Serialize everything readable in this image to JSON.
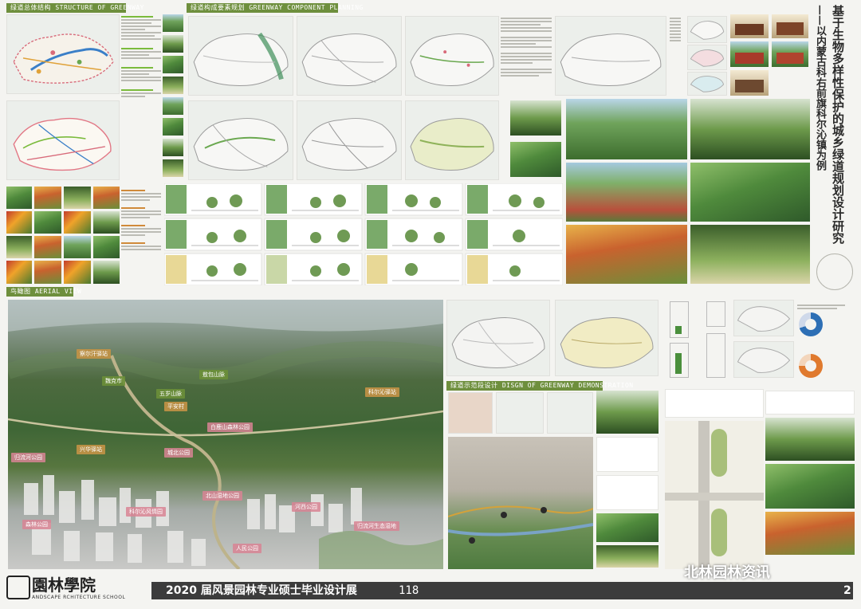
{
  "headers": {
    "structure": "绿道总体结构 STRUCTURE OF GREENWAY",
    "component": "绿道构成要素规划 GREENWAY COMPONENT PLANNING",
    "aerial": "鸟瞰图 AERIAL VIEW",
    "demo": "绿道示范段设计 DISGN OF GREENWAY DEMONSTRATION"
  },
  "title": {
    "main": "基于生物多样性保护的城乡绿道规划设计研究",
    "sub": "——以内蒙古科右前旗科尔沁镇为例"
  },
  "aerial_labels": [
    {
      "text": "察尔汗驿站",
      "style": "o"
    },
    {
      "text": "敖包山脉",
      "style": "g"
    },
    {
      "text": "魏克市",
      "style": "g"
    },
    {
      "text": "五岁山脉",
      "style": "g"
    },
    {
      "text": "平安村",
      "style": "o"
    },
    {
      "text": "科尔沁驿站",
      "style": "p"
    },
    {
      "text": "白鹿山森林公园",
      "style": "p"
    },
    {
      "text": "兴华驿站",
      "style": "o"
    },
    {
      "text": "城北公园",
      "style": "p"
    },
    {
      "text": "归流河公园",
      "style": "p"
    },
    {
      "text": "北山湿地公园",
      "style": "p"
    },
    {
      "text": "科尔沁风情园",
      "style": "p"
    },
    {
      "text": "河西公园",
      "style": "p"
    },
    {
      "text": "归流河生态湿地",
      "style": "p"
    },
    {
      "text": "森林公园",
      "style": "p"
    },
    {
      "text": "人民公园",
      "style": "p"
    }
  ],
  "footer": {
    "school_cn": "園林學院",
    "school_en": "ANDSCAPE RCHITECTURE SCHOOL",
    "exhibition": "2020 届风景园林专业硕士毕业设计展",
    "page": "118",
    "watermark": "北林园林资讯",
    "corner": "2"
  },
  "colors": {
    "header_green": "#6e8f3d",
    "footer_bar": "#3c3c3c",
    "accent_blue": "#2d6fb5",
    "accent_orange": "#e07a2e"
  }
}
